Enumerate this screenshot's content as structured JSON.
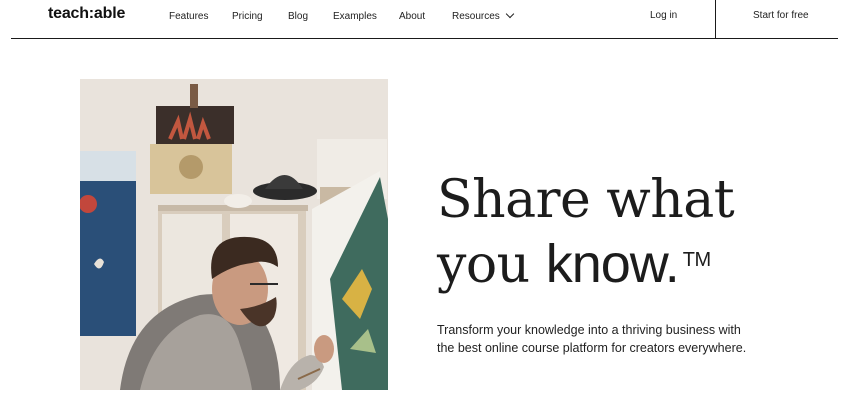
{
  "nav": {
    "logo": "teach:able",
    "links": [
      "Features",
      "Pricing",
      "Blog",
      "Examples",
      "About",
      "Resources"
    ],
    "login": "Log in",
    "cta": "Start for free"
  },
  "hero": {
    "headline_line1": "Share what",
    "headline_line2_a": "you ",
    "headline_line2_b": "know.",
    "trademark": "TM",
    "subtext": "Transform your knowledge into a thriving business with the best online course platform for creators everywhere."
  }
}
